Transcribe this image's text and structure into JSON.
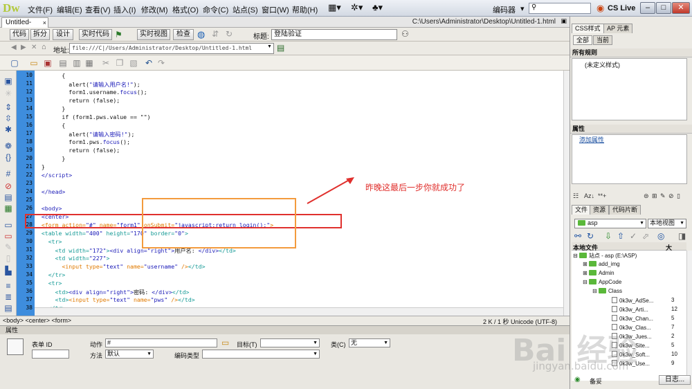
{
  "app": {
    "logo": "Dw",
    "menu": [
      "文件(F)",
      "编辑(E)",
      "查看(V)",
      "插入(I)",
      "修改(M)",
      "格式(O)",
      "命令(C)",
      "站点(S)",
      "窗口(W)",
      "帮助(H)"
    ],
    "workspace": "编码器",
    "cslive": "CS Live"
  },
  "document": {
    "tab": "Untitled-1.html",
    "path": "C:\\Users\\Administrator\\Desktop\\Untitled-1.html",
    "view_buttons": [
      "代码",
      "拆分",
      "设计",
      "实时代码",
      "实时视图",
      "检查"
    ],
    "title_label": "标题:",
    "title_value": "登陆验证",
    "address_label": "地址:",
    "address_value": "file:///C|/Users/Administrator/Desktop/Untitled-1.html"
  },
  "code": {
    "line_numbers": [
      "10",
      "11",
      "12",
      "13",
      "14",
      "15",
      "16",
      "17",
      "18",
      "19",
      "20",
      "21",
      "22",
      "23",
      "24",
      "25",
      "26",
      "27",
      "28",
      "29",
      "30",
      "31",
      "32",
      "33",
      "34",
      "35",
      "36",
      "37",
      "38"
    ]
  },
  "status": {
    "tags": "<body> <center> <form>",
    "info": "2 K / 1 秒  Unicode (UTF-8)"
  },
  "properties": {
    "title": "属性",
    "form_id_label": "表单 ID",
    "action_label": "动作",
    "action_value": "#",
    "target_label": "目标(T)",
    "class_label": "类(C)",
    "class_value": "无",
    "method_label": "方法",
    "method_value": "默认",
    "enctype_label": "编码类型"
  },
  "panel": {
    "tabs": [
      "CSS样式",
      "AP 元素"
    ],
    "subtabs": [
      "全部",
      "当前"
    ],
    "all_rules": "所有规则",
    "undefined_style": "(未定义样式)",
    "attributes": "属性",
    "add_attribute": "添加属性",
    "file_tabs": [
      "文件",
      "资源",
      "代码片断"
    ],
    "site_select": "asp",
    "view_select": "本地视图",
    "local_files": "本地文件",
    "size_col": "大",
    "tree": [
      {
        "label": "站点 - asp (E:\\ASP)",
        "size": ""
      },
      {
        "label": "add_img",
        "size": ""
      },
      {
        "label": "Admin",
        "size": ""
      },
      {
        "label": "AppCode",
        "size": ""
      },
      {
        "label": "Class",
        "size": ""
      },
      {
        "label": "0k3w_AdSe...",
        "size": "3"
      },
      {
        "label": "0k3w_Arti...",
        "size": "12"
      },
      {
        "label": "0k3w_Chan...",
        "size": "5"
      },
      {
        "label": "0k3w_Clas...",
        "size": "7"
      },
      {
        "label": "0k3w_Jues...",
        "size": "2"
      },
      {
        "label": "0k3w_Site...",
        "size": "5"
      },
      {
        "label": "0k3w_Soft...",
        "size": "10"
      },
      {
        "label": "0k3w_Use...",
        "size": "9"
      }
    ],
    "footer_left": "备妥",
    "footer_right": "日志..."
  },
  "annotation": {
    "text": "昨晚这最后一步你就成功了"
  },
  "watermark": {
    "brand": "Bai 经验",
    "url": "jingyan.baidu.com"
  }
}
